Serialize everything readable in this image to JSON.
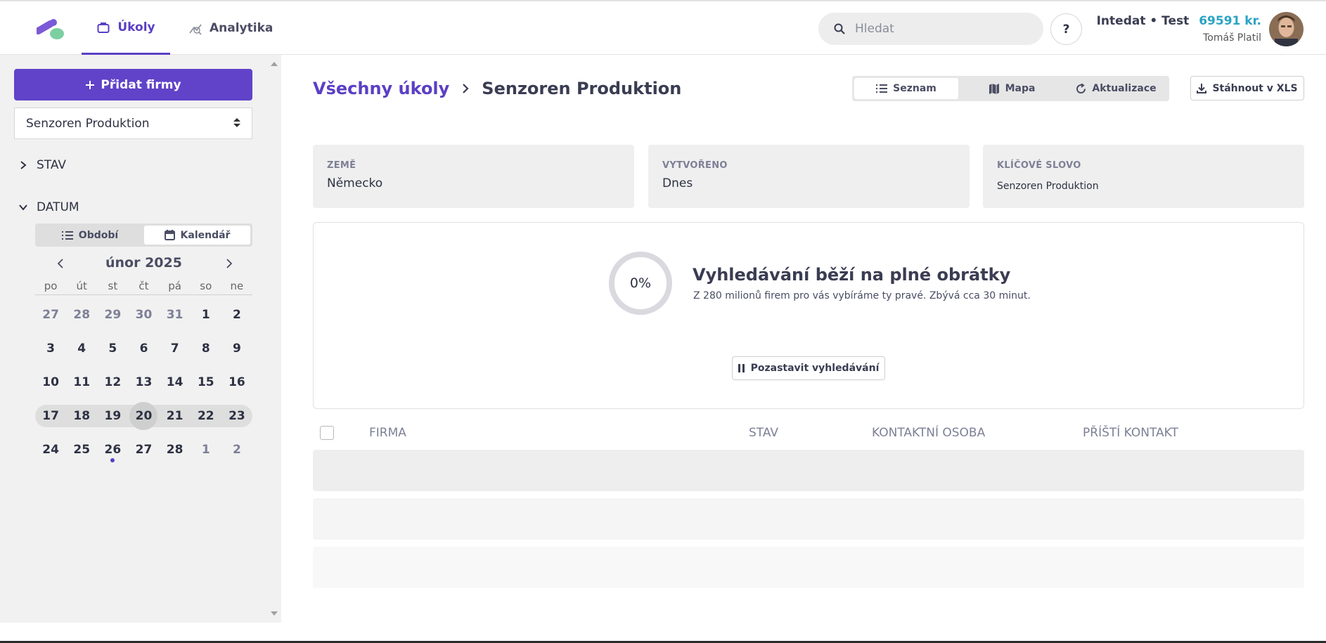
{
  "nav": {
    "tabs": [
      {
        "label": "Úkoly",
        "icon": "briefcase-icon",
        "active": true
      },
      {
        "label": "Analytika",
        "icon": "analytics-icon",
        "active": false
      }
    ]
  },
  "search": {
    "placeholder": "Hledat"
  },
  "help": {
    "label": "?"
  },
  "account": {
    "workspace": "Intedat • Test",
    "credits": "69591 kr.",
    "user": "Tomáš Platil"
  },
  "sidebar": {
    "add_button": "Přidat firmy",
    "selected_company": "Senzoren Produktion",
    "sections": {
      "status": "STAV",
      "date": "DATUM"
    },
    "date_mode": {
      "period": "Období",
      "calendar": "Kalendář",
      "active": "calendar"
    },
    "calendar": {
      "month": "únor 2025",
      "weekdays": [
        "po",
        "út",
        "st",
        "čt",
        "pá",
        "so",
        "ne"
      ],
      "weeks": [
        [
          "27",
          "28",
          "29",
          "30",
          "31",
          "1",
          "2"
        ],
        [
          "3",
          "4",
          "5",
          "6",
          "7",
          "8",
          "9"
        ],
        [
          "10",
          "11",
          "12",
          "13",
          "14",
          "15",
          "16"
        ],
        [
          "17",
          "18",
          "19",
          "20",
          "21",
          "22",
          "23"
        ],
        [
          "24",
          "25",
          "26",
          "27",
          "28",
          "1",
          "2"
        ]
      ],
      "today": "20",
      "highlighted_week": 3
    }
  },
  "main": {
    "breadcrumb": {
      "root": "Všechny úkoly",
      "current": "Senzoren Produktion"
    },
    "views": {
      "list": "Seznam",
      "map": "Mapa",
      "updates": "Aktualizace",
      "active": "list"
    },
    "download": "Stáhnout v XLS",
    "filters": [
      {
        "label": "ZEMĚ",
        "value": "Německo"
      },
      {
        "label": "VYTVOŘENO",
        "value": "Dnes"
      },
      {
        "label": "KLÍČOVÉ SLOVO",
        "value": "Senzoren Produktion"
      }
    ],
    "progress": {
      "percent": "0%",
      "percent_value": 0,
      "title": "Vyhledávání běží na plné obrátky",
      "subtitle": "Z 280 milionů firem pro vás vybíráme ty pravé. Zbývá cca 30 minut.",
      "pause_label": "Pozastavit vyhledávání"
    },
    "table": {
      "columns": [
        "FIRMA",
        "STAV",
        "KONTAKTNÍ OSOBA",
        "PŘÍŠTÍ KONTAKT"
      ]
    }
  },
  "colors": {
    "accent": "#5b3fc4",
    "credits": "#2ba3c4",
    "logo_green": "#7ccfa1"
  }
}
